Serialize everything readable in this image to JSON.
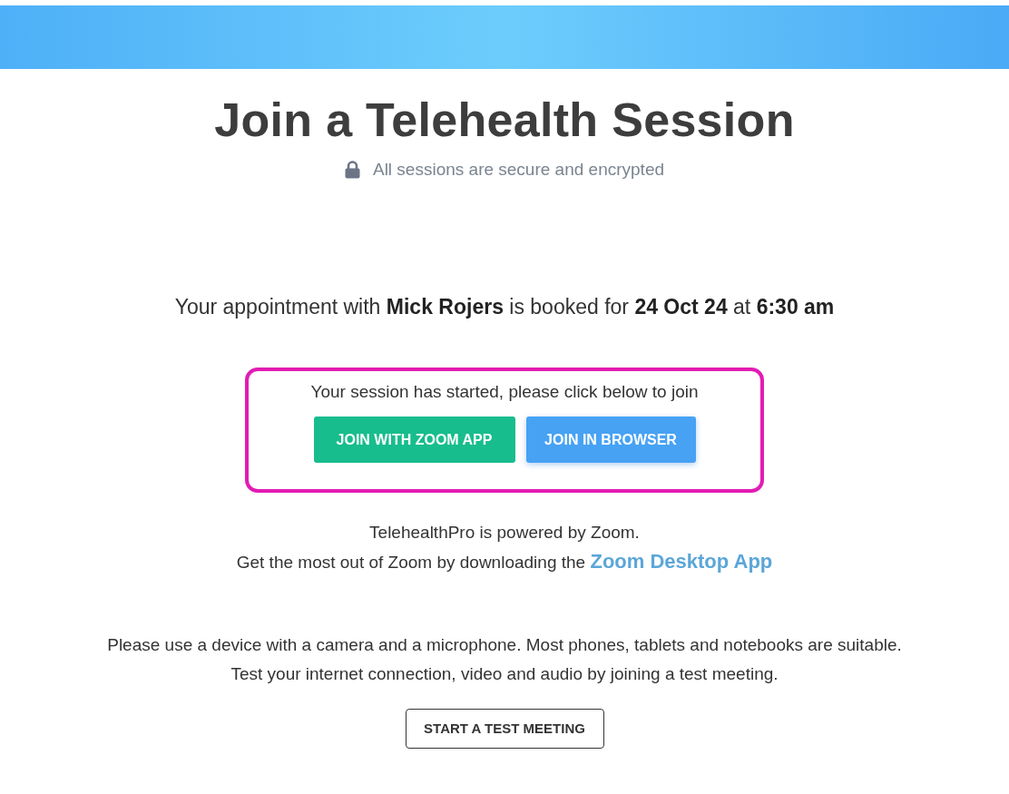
{
  "page": {
    "title": "Join a Telehealth Session",
    "subtitle": "All sessions are secure and encrypted"
  },
  "appointment": {
    "text": "Your appointment with **Mick Rojers** is booked for **24 Oct 24** at **6:30 am**"
  },
  "session_panel": {
    "highlighted": true,
    "message": "Your session has started, please click below to join",
    "buttons": [
      {
        "label": "JOIN WITH ZOOM APP",
        "kind": "app"
      },
      {
        "label": "JOIN IN BROWSER",
        "kind": "browser"
      }
    ]
  },
  "zoom_info": {
    "lines": [
      {
        "text": "TelehealthPro is powered by Zoom."
      },
      {
        "text": "Get the most out of Zoom by downloading the",
        "link": "Zoom Desktop App"
      }
    ]
  },
  "device_note": {
    "lines": [
      "Please use a device with a camera and a microphone. Most phones, tablets and notebooks are suitable.",
      "Test your internet connection, video and audio by joining a test meeting."
    ]
  },
  "test_button": {
    "label": "START A TEST MEETING"
  }
}
